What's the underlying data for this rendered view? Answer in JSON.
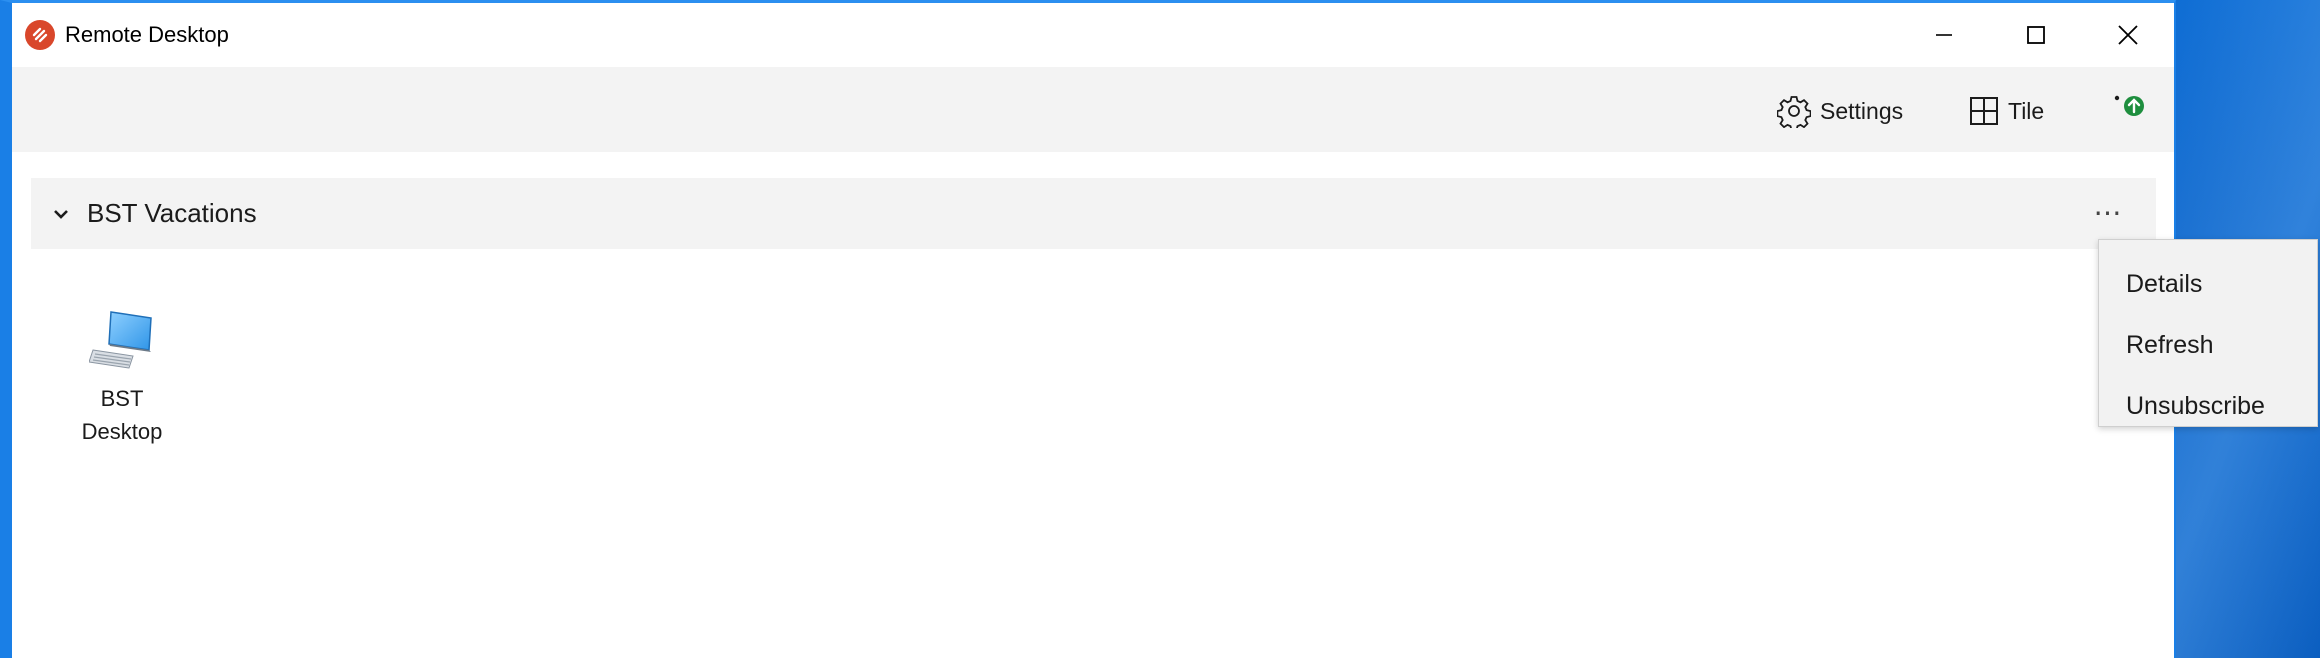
{
  "window": {
    "title": "Remote Desktop",
    "controls": [
      "minimize",
      "maximize",
      "close"
    ]
  },
  "toolbar": {
    "settings_label": "Settings",
    "tile_label": "Tile"
  },
  "workspace": {
    "name": "BST Vacations",
    "more_label": "⋯",
    "resources": [
      {
        "label_line1": "BST",
        "label_line2": "Desktop",
        "icon": "desktop-icon"
      }
    ]
  },
  "context_menu": {
    "items": [
      "Details",
      "Refresh",
      "Unsubscribe"
    ]
  },
  "colors": {
    "accent": "#1a7fe6",
    "logo": "#d9472b",
    "update_badge": "#1e8e3e"
  }
}
